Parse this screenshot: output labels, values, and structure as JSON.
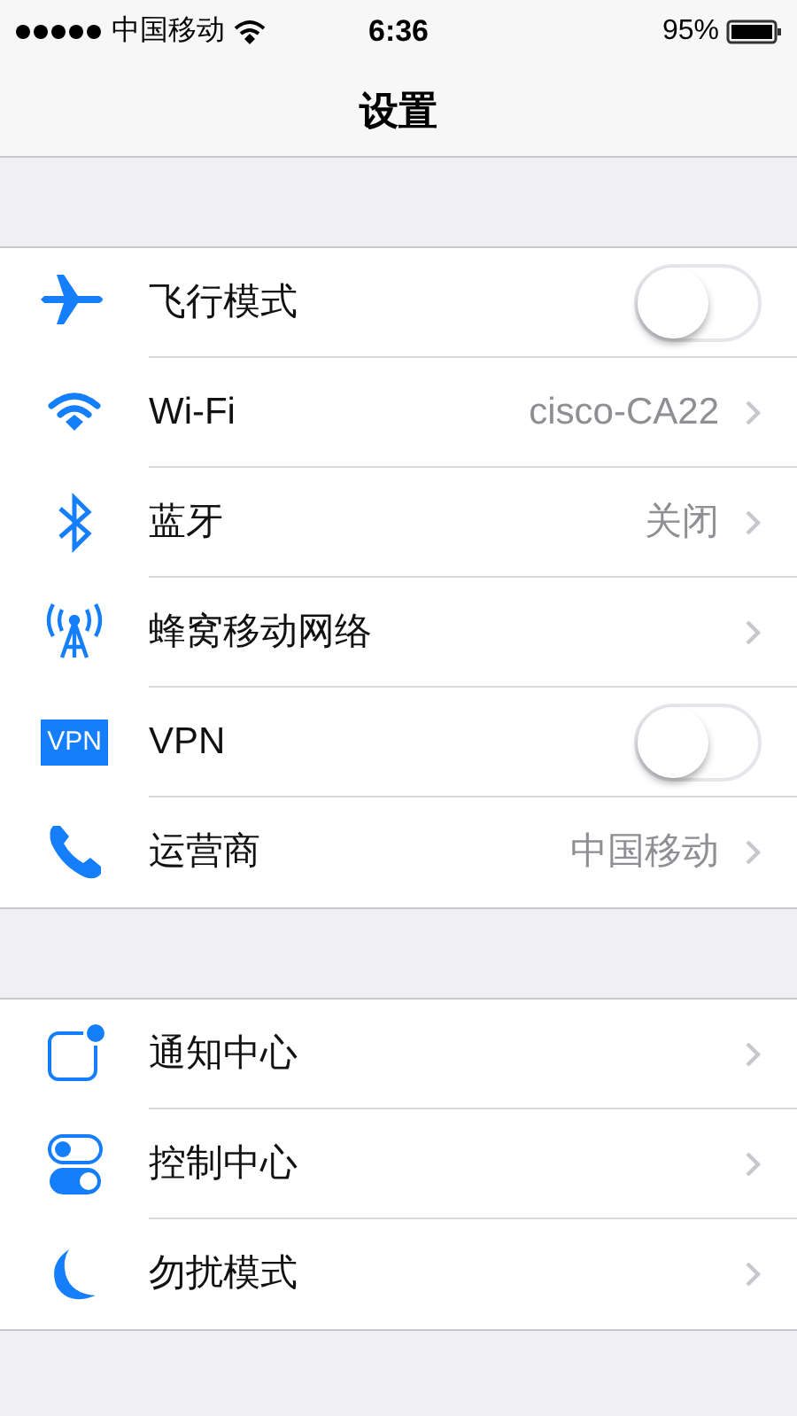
{
  "status_bar": {
    "carrier": "中国移动",
    "time": "6:36",
    "battery": "95%"
  },
  "nav": {
    "title": "设置"
  },
  "groups": [
    {
      "rows": [
        {
          "label": "飞行模式",
          "kind": "toggle",
          "on": false
        },
        {
          "label": "Wi-Fi",
          "kind": "link",
          "value": "cisco-CA22"
        },
        {
          "label": "蓝牙",
          "kind": "link",
          "value": "关闭"
        },
        {
          "label": "蜂窝移动网络",
          "kind": "link"
        },
        {
          "label": "VPN",
          "kind": "toggle",
          "on": false,
          "icon_text": "VPN"
        },
        {
          "label": "运营商",
          "kind": "link",
          "value": "中国移动"
        }
      ]
    },
    {
      "rows": [
        {
          "label": "通知中心",
          "kind": "link"
        },
        {
          "label": "控制中心",
          "kind": "link"
        },
        {
          "label": "勿扰模式",
          "kind": "link"
        }
      ]
    }
  ]
}
